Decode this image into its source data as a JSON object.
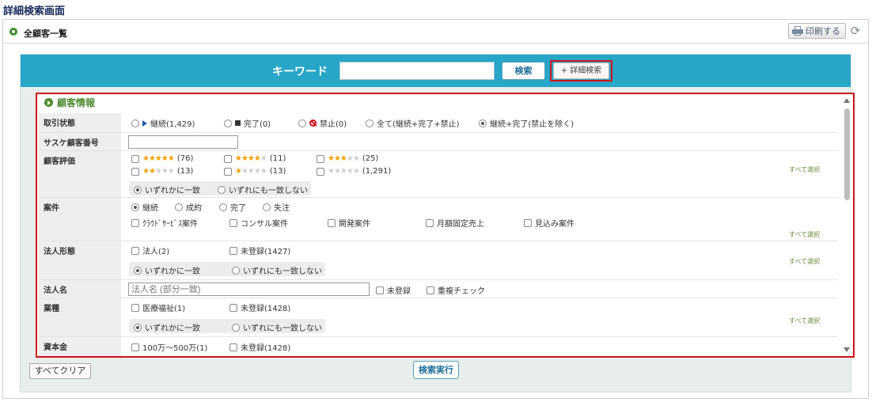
{
  "page_title": "詳細検索画面",
  "panel": {
    "title": "全顧客一覧",
    "print_label": "印刷する"
  },
  "keyword": {
    "label": "キーワード",
    "value": "",
    "search_button": "検索",
    "advanced_button": "+ 詳細検索"
  },
  "section_title": "顧客情報",
  "select_all": "すべて選択",
  "deal_status": {
    "label": "取引状態",
    "options": [
      "継続(1,429)",
      "完了(0)",
      "禁止(0)",
      "全て(継続+完了+禁止)",
      "継続+完了(禁止を除く)"
    ]
  },
  "sasuke_no": {
    "label": "サスケ顧客番号",
    "value": ""
  },
  "rating": {
    "label": "顧客評価",
    "counts": [
      "(76)",
      "(11)",
      "(25)",
      "(13)",
      "(13)",
      "(1,291)"
    ]
  },
  "match_any": "いずれかに一致",
  "match_none": "いずれにも一致しない",
  "project": {
    "label": "案件",
    "statuses": [
      "継続",
      "成約",
      "完了",
      "失注"
    ],
    "types": [
      "ｸﾗｳﾄﾞｻｰﾋﾞｽ案件",
      "コンサル案件",
      "開発案件",
      "月額固定売上",
      "見込み案件"
    ]
  },
  "corp_form": {
    "label": "法人形態",
    "options": [
      "法人(2)",
      "未登録(1427)"
    ]
  },
  "corp_name": {
    "label": "法人名",
    "placeholder": "法人名 (部分一致)",
    "unregistered": "未登録",
    "dup_check": "重複チェック"
  },
  "industry": {
    "label": "業種",
    "options": [
      "医療福祉(1)",
      "未登録(1428)"
    ]
  },
  "capital": {
    "label": "資本金",
    "options": [
      "100万～500万(1)",
      "未登録(1428)"
    ]
  },
  "buttons": {
    "clear": "すべてクリア",
    "execute": "検索実行"
  }
}
